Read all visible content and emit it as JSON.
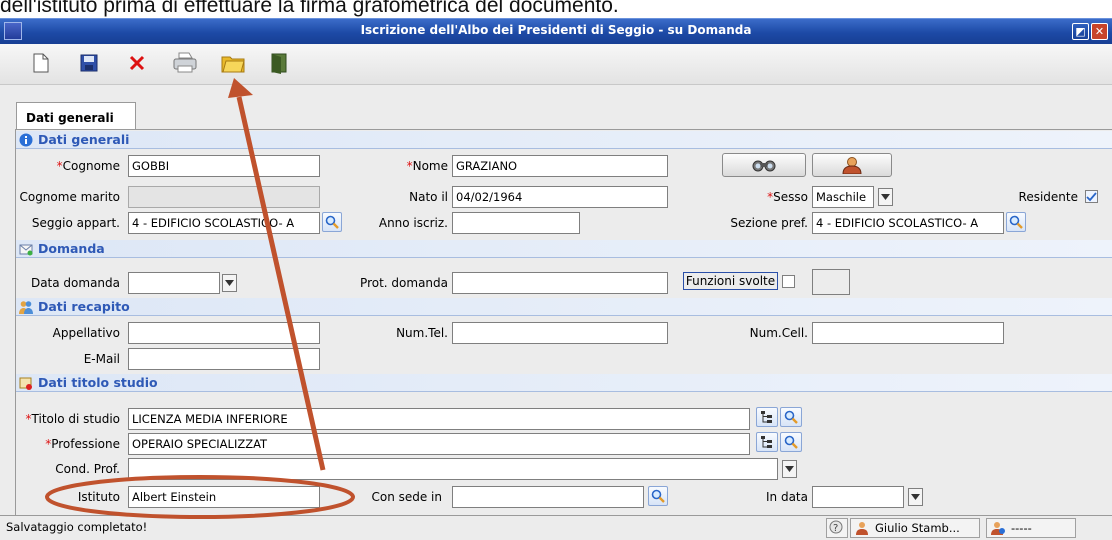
{
  "doc_caption": "dell'istituto prima di effettuare la firma grafometrica del documento.",
  "window": {
    "title": "Iscrizione dell'Albo dei Presidenti di Seggio - su Domanda",
    "restore_glyph": "◩",
    "close_glyph": "✕"
  },
  "toolbar": {
    "items": [
      "new-document-icon",
      "save-icon",
      "delete-icon",
      "print-icon",
      "folder-icon",
      "exit-door-icon"
    ]
  },
  "tab": {
    "label": "Dati generali"
  },
  "sections": {
    "generali": "Dati generali",
    "domanda": "Domanda",
    "recapito": "Dati recapito",
    "titolo": "Dati titolo studio"
  },
  "fields": {
    "cognome": {
      "label": "Cognome",
      "value": "GOBBI"
    },
    "nome": {
      "label": "Nome",
      "value": "GRAZIANO"
    },
    "cognome_marito": {
      "label": "Cognome marito",
      "value": ""
    },
    "nato_il": {
      "label": "Nato il",
      "value": "04/02/1964"
    },
    "sesso": {
      "label": "Sesso",
      "value": "Maschile"
    },
    "residente": {
      "label": "Residente",
      "checked": true
    },
    "seggio": {
      "label": "Seggio appart.",
      "value": "4 - EDIFICIO SCOLASTICO- A"
    },
    "anno_iscriz": {
      "label": "Anno iscriz.",
      "value": ""
    },
    "sezione_pref": {
      "label": "Sezione pref.",
      "value": "4 - EDIFICIO SCOLASTICO- A"
    },
    "data_domanda": {
      "label": "Data domanda",
      "value": ""
    },
    "prot_domanda": {
      "label": "Prot. domanda",
      "value": ""
    },
    "funzioni_svolte": {
      "label": "Funzioni svolte",
      "checked": false
    },
    "appellativo": {
      "label": "Appellativo",
      "value": ""
    },
    "num_tel": {
      "label": "Num.Tel.",
      "value": ""
    },
    "num_cell": {
      "label": "Num.Cell.",
      "value": ""
    },
    "email": {
      "label": "E-Mail",
      "value": ""
    },
    "titolo_studio": {
      "label": "Titolo di studio",
      "value": "LICENZA MEDIA INFERIORE"
    },
    "professione": {
      "label": "Professione",
      "value": "OPERAIO SPECIALIZZAT"
    },
    "cond_prof": {
      "label": "Cond. Prof.",
      "value": ""
    },
    "istituto": {
      "label": "Istituto",
      "value": "Albert Einstein"
    },
    "con_sede_in": {
      "label": "Con sede in",
      "value": ""
    },
    "in_data": {
      "label": "In data",
      "value": ""
    }
  },
  "required_marker": "*",
  "status": {
    "message": "Salvataggio completato!",
    "user": "Giulio Stamb...",
    "info": "-----"
  },
  "colors": {
    "annotation": "#c0522d",
    "title_bar": "#1d4aa6",
    "section_text": "#2e59b6"
  }
}
